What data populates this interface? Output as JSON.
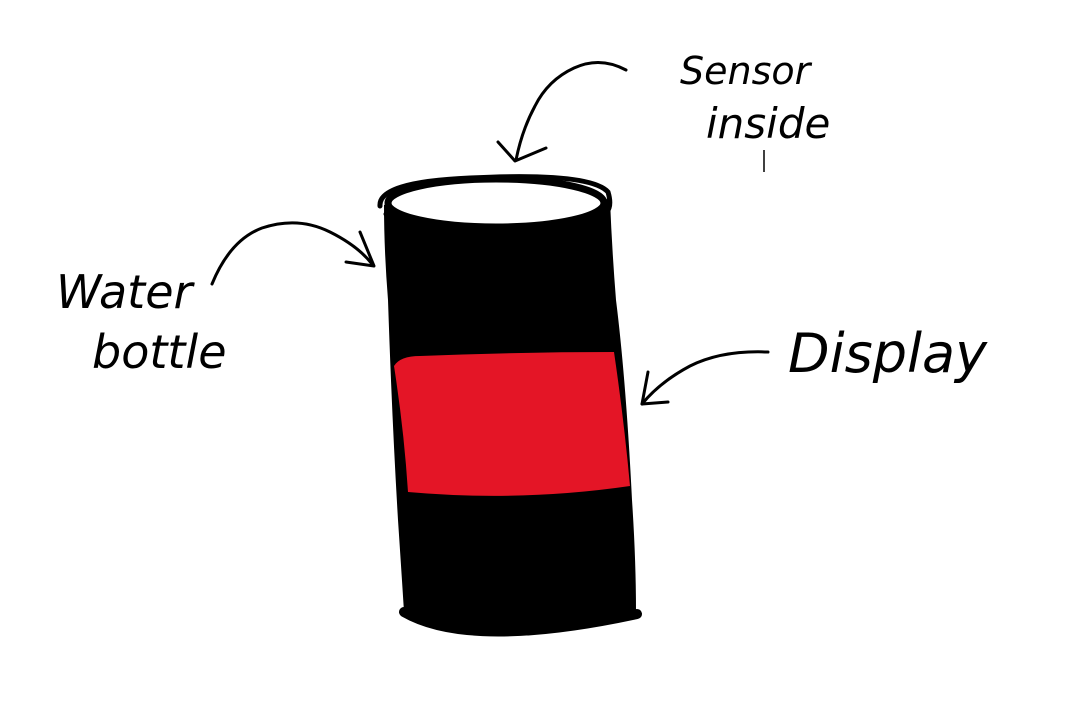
{
  "labels": {
    "sensor_line1": "Sensor",
    "sensor_line2": "inside",
    "water_line1": "Water",
    "water_line2": "bottle",
    "display": "Display"
  },
  "colors": {
    "ink": "#000000",
    "bottle_body": "#000000",
    "display_band": "#e41526",
    "bottle_top": "#ffffff",
    "background": "#ffffff"
  }
}
